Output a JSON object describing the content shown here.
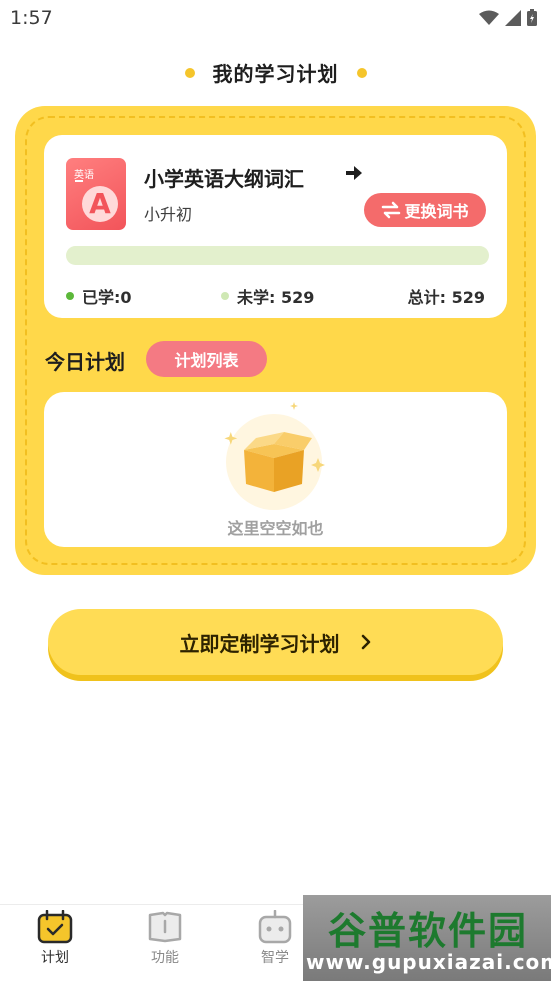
{
  "status_bar": {
    "time": "1:57"
  },
  "header": {
    "title": "我的学习计划"
  },
  "book": {
    "cover_label": "英语",
    "cover_letter": "A",
    "title": "小学英语大纲词汇",
    "subtitle": "小升初",
    "change_label": "更换词书",
    "progress": 0,
    "learned_label": "已学:",
    "learned_count": "0",
    "unlearned_label": "未学:",
    "unlearned_count": "529",
    "total_label": "总计:",
    "total_count": "529"
  },
  "today": {
    "title": "今日计划",
    "list_tab": "计划列表",
    "empty_text": "这里空空如也"
  },
  "cta": {
    "label": "立即定制学习计划"
  },
  "nav": {
    "items": [
      {
        "label": "计划",
        "icon": "calendar-check-icon",
        "active": true
      },
      {
        "label": "功能",
        "icon": "book-open-icon",
        "active": false
      },
      {
        "label": "智学",
        "icon": "robot-icon",
        "active": false
      }
    ]
  },
  "watermark": {
    "line1": "谷普软件园",
    "line2": "www.gupuxiazai.com"
  },
  "colors": {
    "panel_yellow": "#ffd84a",
    "accent_red": "#f46b6b",
    "tab_pink": "#f47a83",
    "learned_dot": "#5cb83a",
    "unlearned_dot": "#cfe8b4",
    "nav_active": "#f5c52b"
  }
}
